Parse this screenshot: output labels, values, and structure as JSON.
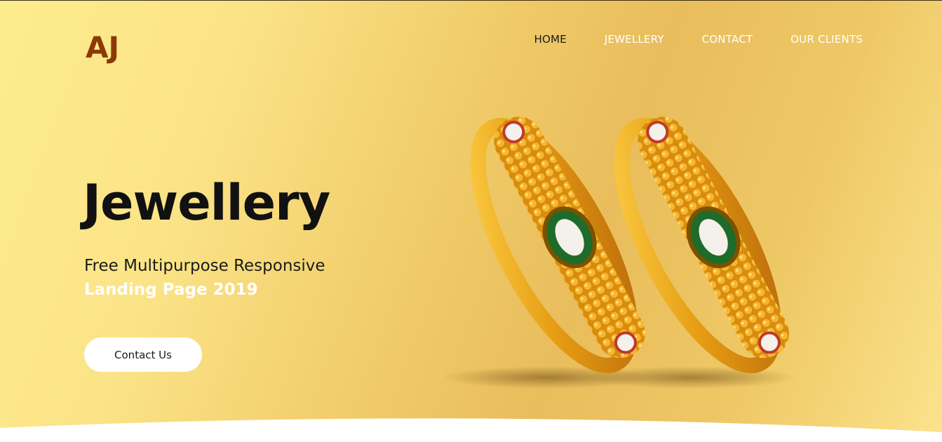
{
  "brand": {
    "logo_text": "AJ",
    "logo_color": "#8b3a05"
  },
  "nav": {
    "items": [
      {
        "label": "HOME",
        "active": true
      },
      {
        "label": "JEWELLERY",
        "active": false
      },
      {
        "label": "CONTACT",
        "active": false
      },
      {
        "label": "OUR CLIENTS",
        "active": false
      }
    ]
  },
  "hero": {
    "title": "Jewellery",
    "subtitle_line1": "Free Multipurpose Responsive",
    "subtitle_line2": "Landing Page 2019",
    "cta_label": "Contact Us"
  },
  "image": {
    "alt": "two-gold-bangles"
  },
  "colors": {
    "accent_gold": "#e9bd5c",
    "light_gold": "#fdec8c",
    "text_dark": "#111111",
    "white": "#ffffff"
  }
}
